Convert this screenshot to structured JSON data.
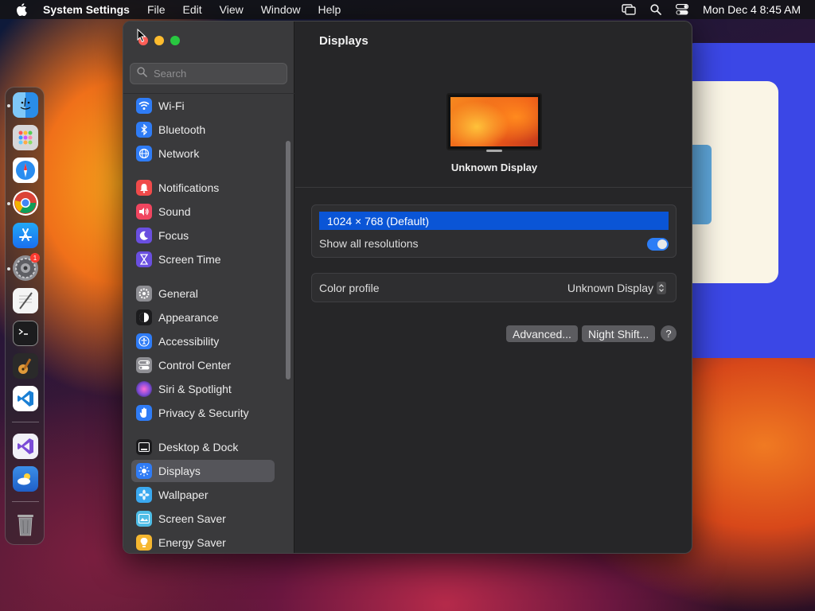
{
  "menubar": {
    "app_name": "System Settings",
    "menus": [
      "File",
      "Edit",
      "View",
      "Window",
      "Help"
    ],
    "datetime": "Mon Dec 4  8:45 AM",
    "status_icons": [
      "screen-mirroring-icon",
      "spotlight-search-icon",
      "control-center-icon"
    ]
  },
  "dock": {
    "apps": [
      {
        "name": "Finder",
        "icon": "finder-icon",
        "running": true
      },
      {
        "name": "Launchpad",
        "icon": "launchpad-icon",
        "running": false
      },
      {
        "name": "Safari",
        "icon": "safari-icon",
        "running": false
      },
      {
        "name": "Google Chrome",
        "icon": "chrome-icon",
        "running": true
      },
      {
        "name": "App Store",
        "icon": "app-store-icon",
        "running": false
      },
      {
        "name": "System Settings",
        "icon": "system-settings-icon",
        "running": true,
        "badge": "1"
      },
      {
        "name": "TextEdit",
        "icon": "textedit-icon",
        "running": false
      },
      {
        "name": "Terminal",
        "icon": "terminal-icon",
        "running": false
      },
      {
        "name": "GarageBand",
        "icon": "garageband-icon",
        "running": false
      },
      {
        "name": "Visual Studio Code",
        "icon": "vscode-icon",
        "running": false
      },
      {
        "name": "Visual Studio",
        "icon": "visual-studio-icon",
        "running": false
      },
      {
        "name": "Weather",
        "icon": "weather-icon",
        "running": false
      },
      {
        "name": "Trash",
        "icon": "trash-icon",
        "running": false
      }
    ]
  },
  "sidebar": {
    "search_placeholder": "Search",
    "items": [
      {
        "label": "Wi-Fi",
        "icon": "wifi-icon",
        "color": "#2f7cf6"
      },
      {
        "label": "Bluetooth",
        "icon": "bluetooth-icon",
        "color": "#2f7cf6"
      },
      {
        "label": "Network",
        "icon": "network-icon",
        "color": "#2f7cf6"
      },
      {
        "label": "Notifications",
        "icon": "notifications-icon",
        "color": "#f04a4a"
      },
      {
        "label": "Sound",
        "icon": "sound-icon",
        "color": "#f0455f"
      },
      {
        "label": "Focus",
        "icon": "focus-icon",
        "color": "#6a4fe0"
      },
      {
        "label": "Screen Time",
        "icon": "screen-time-icon",
        "color": "#6a4fe0"
      },
      {
        "label": "General",
        "icon": "general-icon",
        "color": "#8e8e93"
      },
      {
        "label": "Appearance",
        "icon": "appearance-icon",
        "color": "#1c1c1e"
      },
      {
        "label": "Accessibility",
        "icon": "accessibility-icon",
        "color": "#2f7cf6"
      },
      {
        "label": "Control Center",
        "icon": "control-center-icon",
        "color": "#8e8e93"
      },
      {
        "label": "Siri & Spotlight",
        "icon": "siri-icon",
        "color": "#c44bd8"
      },
      {
        "label": "Privacy & Security",
        "icon": "privacy-icon",
        "color": "#2f7cf6"
      },
      {
        "label": "Desktop & Dock",
        "icon": "desktop-dock-icon",
        "color": "#1c1c1e"
      },
      {
        "label": "Displays",
        "icon": "displays-icon",
        "color": "#2f7cf6",
        "selected": true
      },
      {
        "label": "Wallpaper",
        "icon": "wallpaper-icon",
        "color": "#3aa9f0"
      },
      {
        "label": "Screen Saver",
        "icon": "screen-saver-icon",
        "color": "#4fbde6"
      },
      {
        "label": "Energy Saver",
        "icon": "energy-saver-icon",
        "color": "#f5b730"
      }
    ]
  },
  "main": {
    "title": "Displays",
    "display_name": "Unknown Display",
    "resolution_selected": "1024 × 768 (Default)",
    "show_all_resolutions_label": "Show all resolutions",
    "show_all_resolutions_on": true,
    "color_profile_label": "Color profile",
    "color_profile_value": "Unknown Display",
    "advanced_button": "Advanced...",
    "night_shift_button": "Night Shift...",
    "help_button": "?"
  }
}
